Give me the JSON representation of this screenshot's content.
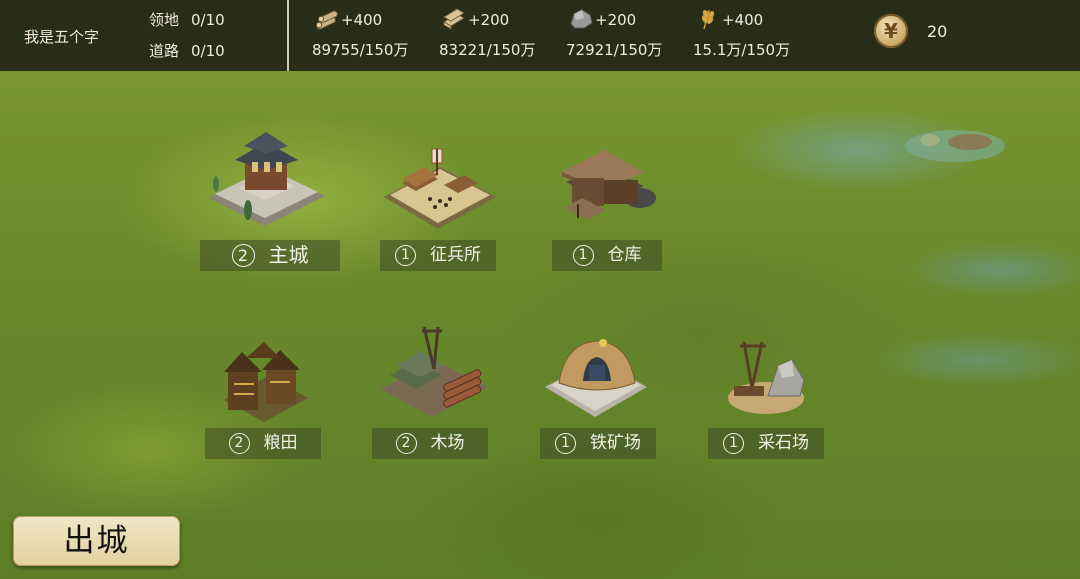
{
  "player": {
    "name": "我是五个字",
    "territory_label": "领地",
    "territory_value": "0/10",
    "road_label": "道路",
    "road_value": "0/10"
  },
  "resources": [
    {
      "icon": "wood-log-icon",
      "gain": "+400",
      "stock": "89755/150万"
    },
    {
      "icon": "timber-plank-icon",
      "gain": "+200",
      "stock": "83221/150万"
    },
    {
      "icon": "stone-icon",
      "gain": "+200",
      "stock": "72921/150万"
    },
    {
      "icon": "wheat-icon",
      "gain": "+400",
      "stock": "15.1万/150万"
    }
  ],
  "currency": {
    "icon": "yuan-coin-icon",
    "symbol": "¥",
    "amount": "20"
  },
  "buildings": [
    {
      "level": "2",
      "name": "主城",
      "icon": "main-city-building"
    },
    {
      "level": "1",
      "name": "征兵所",
      "icon": "recruitment-building"
    },
    {
      "level": "1",
      "name": "仓库",
      "icon": "warehouse-building"
    },
    {
      "level": "2",
      "name": "粮田",
      "icon": "farm-building"
    },
    {
      "level": "2",
      "name": "木场",
      "icon": "lumber-mill-building"
    },
    {
      "level": "1",
      "name": "铁矿场",
      "icon": "iron-mine-building"
    },
    {
      "level": "1",
      "name": "采石场",
      "icon": "quarry-building"
    }
  ],
  "exit_button": {
    "label": "出城"
  },
  "colors": {
    "topbar_bg": "#1c1e14",
    "grass": "#6f8f2e",
    "button_gold": "#e2d0a0",
    "text_light": "#f1ecdc"
  }
}
